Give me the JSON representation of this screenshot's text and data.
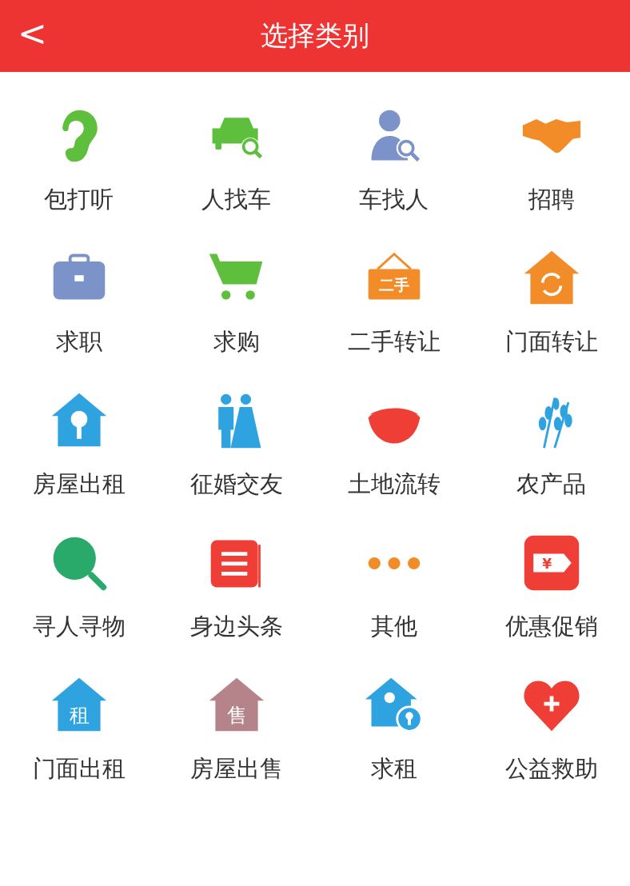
{
  "header": {
    "back": "<",
    "title": "选择类别"
  },
  "categories": [
    {
      "label": "包打听",
      "kind": "ear",
      "color": "#5dbf3c"
    },
    {
      "label": "人找车",
      "kind": "car",
      "color": "#5dbf3c"
    },
    {
      "label": "车找人",
      "kind": "person",
      "color": "#7b93c9"
    },
    {
      "label": "招聘",
      "kind": "handshake",
      "color": "#f28c28"
    },
    {
      "label": "求职",
      "kind": "briefcase",
      "color": "#7b93c9"
    },
    {
      "label": "求购",
      "kind": "cart",
      "color": "#5dbf3c"
    },
    {
      "label": "二手转让",
      "kind": "sign",
      "color": "#f28c28",
      "badge": "二手"
    },
    {
      "label": "门面转让",
      "kind": "house-refresh",
      "color": "#f28c28"
    },
    {
      "label": "房屋出租",
      "kind": "house-key",
      "color": "#2fa3e0"
    },
    {
      "label": "征婚交友",
      "kind": "couple",
      "color": "#2fa3e0"
    },
    {
      "label": "土地流转",
      "kind": "land",
      "color": "#ee3e36"
    },
    {
      "label": "农产品",
      "kind": "wheat",
      "color": "#2fa3e0"
    },
    {
      "label": "寻人寻物",
      "kind": "search",
      "color": "#2aaa6a"
    },
    {
      "label": "身边头条",
      "kind": "news",
      "color": "#ee3e36"
    },
    {
      "label": "其他",
      "kind": "dots",
      "color": "#f28c28"
    },
    {
      "label": "优惠促销",
      "kind": "tag",
      "color": "#ee3e36",
      "badge": "¥"
    },
    {
      "label": "门面出租",
      "kind": "house-text",
      "color": "#2fa3e0",
      "badge": "租"
    },
    {
      "label": "房屋出售",
      "kind": "house-text",
      "color": "#b5848a",
      "badge": "售"
    },
    {
      "label": "求租",
      "kind": "house-lock",
      "color": "#2fa3e0"
    },
    {
      "label": "公益救助",
      "kind": "heart",
      "color": "#ee3e36"
    }
  ]
}
